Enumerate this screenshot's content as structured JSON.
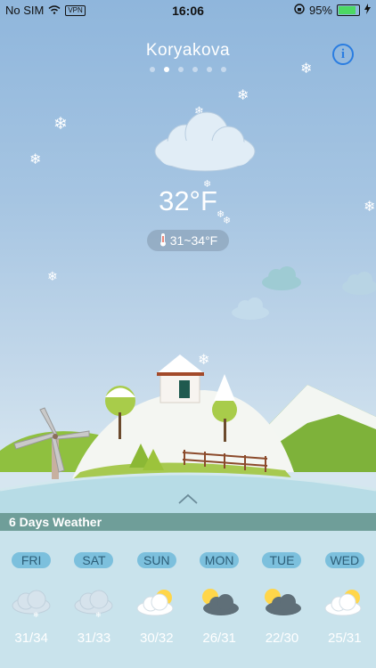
{
  "status_bar": {
    "carrier": "No SIM",
    "vpn": "VPN",
    "time": "16:06",
    "battery": "95%",
    "battery_level": 0.95
  },
  "header": {
    "city": "Koryakova",
    "page_count": 6,
    "active_page": 1,
    "info_icon": "info-icon"
  },
  "current": {
    "temperature": "32°F",
    "range": "31~34°F",
    "condition_icon": "cloud-icon"
  },
  "forecast": {
    "title": "6 Days Weather",
    "days": [
      {
        "day": "FRI",
        "icon": "snow-cloud-icon",
        "temps": "31/34"
      },
      {
        "day": "SAT",
        "icon": "snow-cloud-icon",
        "temps": "31/33"
      },
      {
        "day": "SUN",
        "icon": "sun-cloud-icon",
        "temps": "30/32"
      },
      {
        "day": "MON",
        "icon": "sun-dark-cloud-icon",
        "temps": "26/31"
      },
      {
        "day": "TUE",
        "icon": "sun-dark-cloud-icon",
        "temps": "22/30"
      },
      {
        "day": "WED",
        "icon": "sun-cloud-icon",
        "temps": "25/31"
      }
    ]
  },
  "colors": {
    "sky_top": "#8fb6dc",
    "forecast_bar": "#6f9e99",
    "forecast_bg": "#c9e3ec",
    "pill": "#7cc0dd",
    "info_blue": "#2a7de1"
  }
}
